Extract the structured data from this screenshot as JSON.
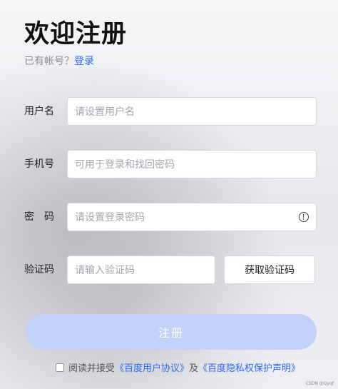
{
  "title": "欢迎注册",
  "login_prompt": {
    "text": "已有帐号？",
    "link": "登录"
  },
  "form": {
    "username": {
      "label": "用户名",
      "placeholder": "请设置用户名"
    },
    "phone": {
      "label": "手机号",
      "placeholder": "可用于登录和找回密码"
    },
    "password": {
      "label": "密　码",
      "placeholder": "请设置登录密码",
      "toggle_icon": "info-eye-icon"
    },
    "verify": {
      "label": "验证码",
      "placeholder": "请输入验证码",
      "button_label": "获取验证码"
    }
  },
  "submit": {
    "label": "注册",
    "color": "#c2d2fb"
  },
  "agreement": {
    "text_before": "阅读并接受",
    "link1": "《百度用户协议》",
    "middle": "及",
    "link2": "《百度隐私权保护声明》"
  },
  "watermark": "CSDN @Qyqf",
  "colors": {
    "link": "#2f6bff",
    "text": "#222222",
    "placeholder": "#a4a8ae"
  }
}
